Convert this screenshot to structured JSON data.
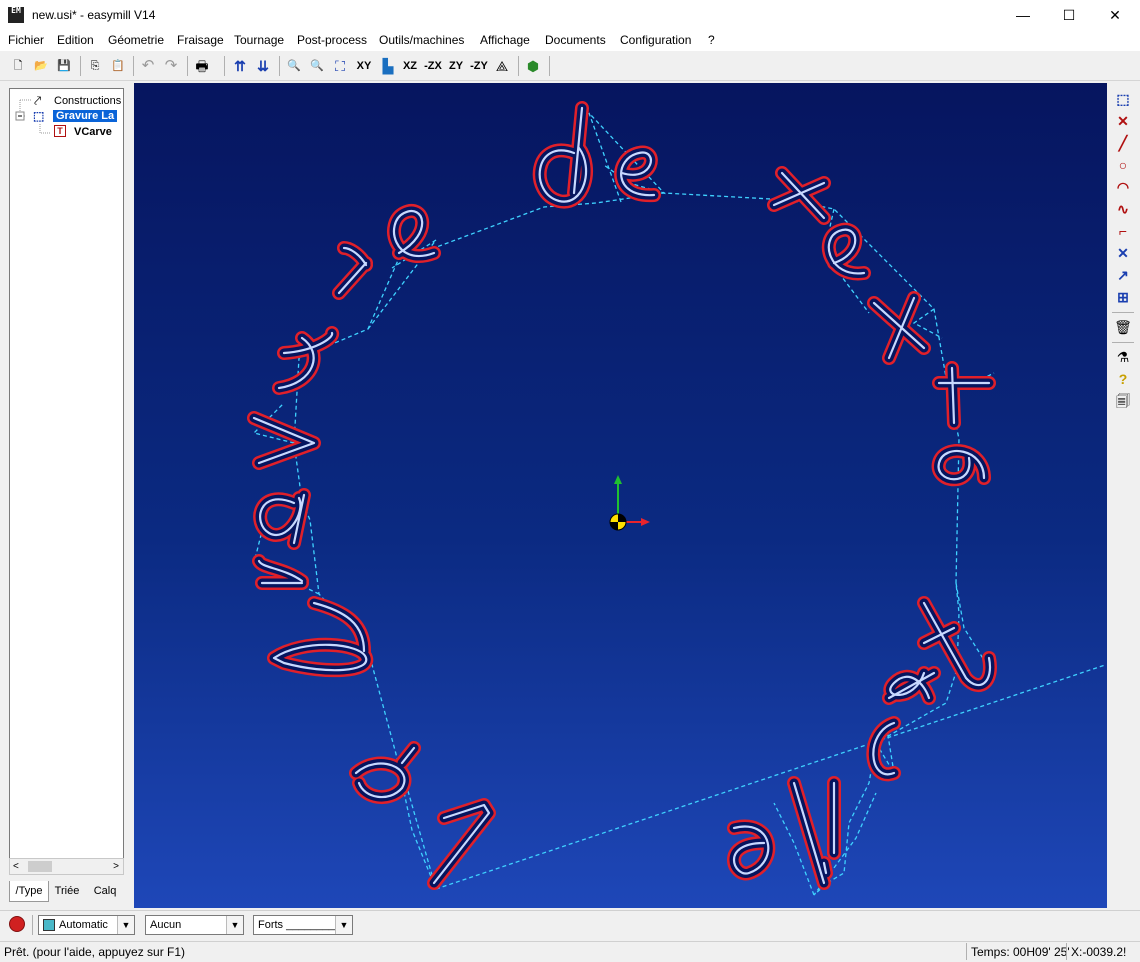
{
  "window": {
    "title": "new.usi* - easymill V14",
    "icon_label": "EM",
    "minimize": "—",
    "maximize": "☐",
    "close": "✕"
  },
  "menu": [
    "Fichier",
    "Edition",
    "Géometrie",
    "Fraisage",
    "Tournage",
    "Post-process",
    "Outils/machines",
    "Affichage",
    "Documents",
    "Configuration",
    "?"
  ],
  "toolbar": {
    "new": "🗋",
    "open": "📂",
    "save": "💾",
    "copy": "⎘",
    "paste": "📋",
    "undo": "↶",
    "redo": "↷",
    "print": "🖶",
    "tool_a": "⇈",
    "tool_b": "⇊",
    "zoom_out": "🔍",
    "zoom_in": "🔍",
    "zoom_fit": "⛶",
    "view_xy": "XY",
    "view_xz": "XZ",
    "view_mzx": "-ZX",
    "view_zy": "ZY",
    "view_mzy": "-ZY",
    "view_iso": "⟁",
    "view_3d": "⬢"
  },
  "tree": {
    "constructions": "Constructions",
    "gravure": "Gravure  La",
    "vcarve": "VCarve"
  },
  "panel_tabs": [
    "/Type",
    "Triée",
    "Calq"
  ],
  "right_toolbar": [
    "⬚",
    "✕",
    "╱",
    "○",
    "◠",
    "∿",
    "⌐",
    "✕",
    "↗",
    "⊞",
    "🗑",
    "⚗",
    "?",
    "🗐"
  ],
  "bottom": {
    "combo1": "Automatic",
    "combo2": "Aucun",
    "combo3": "Forts ________"
  },
  "status": {
    "left": "Prêt. (pour l'aide, appuyez sur F1)",
    "time": "Temps: 00H09' 25'",
    "coord": "X:-0039.2!"
  },
  "colors": {
    "viewport_top": "#06155f",
    "viewport_bottom": "#1e47b8",
    "toolpath_outline": "#e0202a",
    "toolpath_center": "#c8d8ff",
    "rapid_moves": "#3fd2ff",
    "axis_x": "#e8242c",
    "axis_y": "#20c030"
  }
}
